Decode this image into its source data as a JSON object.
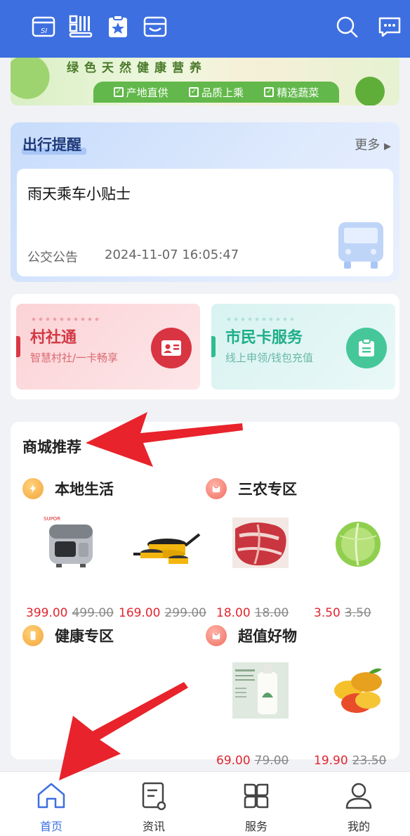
{
  "banner": {
    "slogan": "绿色天然健康营养",
    "tags": [
      "产地直供",
      "品质上乘",
      "精选蔬菜"
    ]
  },
  "travel": {
    "title": "出行提醒",
    "more": "更多",
    "notice_title": "雨天乘车小贴士",
    "notice_type": "公交公告",
    "notice_time": "2024-11-07 16:05:47"
  },
  "quick": [
    {
      "name": "村社通",
      "sub": "智慧村社/一卡畅享"
    },
    {
      "name": "市民卡服务",
      "sub": "线上申领/钱包充值"
    }
  ],
  "mall": {
    "title": "商城推荐",
    "categories": [
      {
        "label": "本地生活",
        "icon": "orange"
      },
      {
        "label": "三农专区",
        "icon": "pink"
      },
      {
        "label": "健康专区",
        "icon": "orange"
      },
      {
        "label": "超值好物",
        "icon": "pink"
      }
    ],
    "products": [
      {
        "name": "rice-cooker",
        "price": "399.00",
        "old": "499.00"
      },
      {
        "name": "cookware-set",
        "price": "169.00",
        "old": "299.00"
      },
      {
        "name": "pork-meat",
        "price": "18.00",
        "old": "18.00"
      },
      {
        "name": "cabbage",
        "price": "3.50",
        "old": "3.50"
      },
      {
        "name": "shampoo-bottle",
        "price": "69.00",
        "old": "79.00"
      },
      {
        "name": "mango",
        "price": "19.90",
        "old": "23.50"
      }
    ]
  },
  "nav": [
    {
      "label": "首页",
      "icon": "home-icon",
      "active": true
    },
    {
      "label": "资讯",
      "icon": "news-icon",
      "active": false
    },
    {
      "label": "服务",
      "icon": "services-icon",
      "active": false
    },
    {
      "label": "我的",
      "icon": "profile-icon",
      "active": false
    }
  ],
  "colors": {
    "primary": "#3d6fe0",
    "price_red": "#e1262f",
    "annotation_arrow": "#e8232b"
  }
}
